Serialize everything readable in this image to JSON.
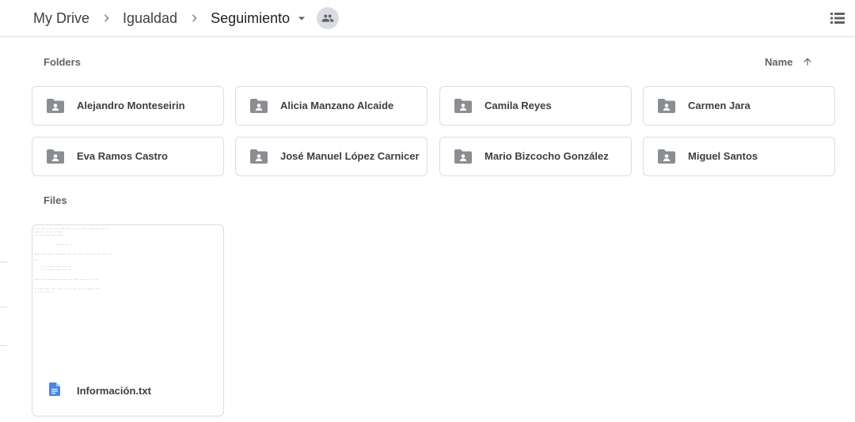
{
  "breadcrumb": {
    "items": [
      "My Drive",
      "Igualdad",
      "Seguimiento"
    ]
  },
  "sections": {
    "folders_title": "Folders",
    "files_title": "Files"
  },
  "sort": {
    "label": "Name",
    "direction": "ascending"
  },
  "folders": [
    "Alejandro Monteseirin",
    "Alicia Manzano Alcaide",
    "Camila Reyes",
    "Carmen Jara",
    "Eva Ramos Castro",
    "José Manuel López Carnicer",
    "Mario Bizcocho González",
    "Miguel Santos"
  ],
  "files": [
    {
      "name": "Información.txt",
      "type": "text-document"
    }
  ],
  "icons": {
    "breadcrumb_separator": "chevron-right-icon",
    "folder_menu": "arrow-drop-down-icon",
    "shared": "people-icon",
    "view_toggle": "list-view-icon",
    "sort": "arrow-upward-icon",
    "folder": "shared-folder-icon",
    "file": "docs-file-icon"
  },
  "colors": {
    "folder_icon": "#8a8d91",
    "file_icon": "#4285f4",
    "border": "#dadce0",
    "text": "#3c4043"
  }
}
